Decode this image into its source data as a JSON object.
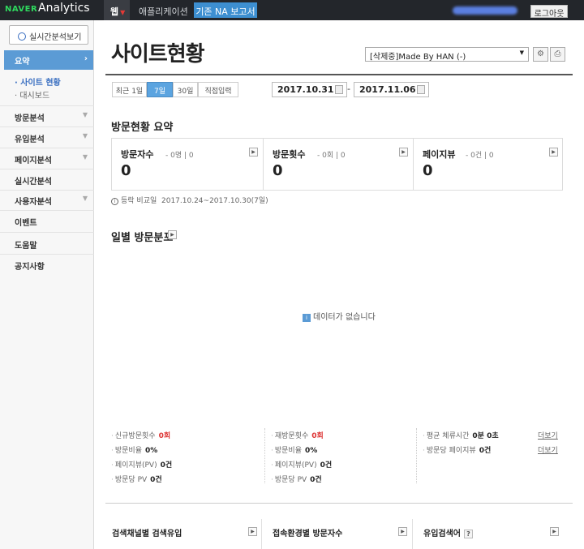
{
  "topbar": {
    "brand_naver": "NAVER",
    "brand_analytics": "Analytics",
    "nav_web": "웹",
    "nav_app": "애플리케이션",
    "nav_legacy": "기존 NA 보고서",
    "logout": "로그아웃"
  },
  "sidebar": {
    "realtime_button": "실시간분석보기",
    "summary": "요약",
    "sub_site": "· 사이트 현황",
    "sub_dashboard": "· 대시보드",
    "menus": [
      "방문분석",
      "유입분석",
      "페이지분석",
      "실시간분석",
      "사용자분석",
      "이벤트",
      "도움말",
      "공지사항"
    ]
  },
  "header": {
    "title": "사이트현황",
    "site_select": "[삭제중]Made By HAN (-)"
  },
  "date_range": {
    "tabs": [
      "최근 1일",
      "7일",
      "30일",
      "직접입력"
    ],
    "active_tab": "7일",
    "start": "2017.10.31",
    "end": "2017.11.06",
    "separator": "-"
  },
  "summary": {
    "title": "방문현황 요약",
    "cards": [
      {
        "label": "방문자수",
        "sub": "- 0명 | 0",
        "value": "0"
      },
      {
        "label": "방문횟수",
        "sub": "- 0회 | 0",
        "value": "0"
      },
      {
        "label": "페이지뷰",
        "sub": "- 0건 | 0",
        "value": "0"
      }
    ],
    "compare_label": "등락 비교일",
    "compare_range": "2017.10.24~2017.10.30(7일)"
  },
  "daily": {
    "title": "일별 방문분포",
    "no_data": "데이터가 없습니다",
    "no_data_badge": "i"
  },
  "stats": {
    "col1": [
      {
        "label": "신규방문횟수",
        "value": "0회"
      },
      {
        "label": "방문비율",
        "value": "0%"
      },
      {
        "label": "페이지뷰(PV)",
        "value": "0건"
      },
      {
        "label": "방문당 PV",
        "value": "0건"
      }
    ],
    "col2": [
      {
        "label": "재방문횟수",
        "value": "0회"
      },
      {
        "label": "방문비율",
        "value": "0%"
      },
      {
        "label": "페이지뷰(PV)",
        "value": "0건"
      },
      {
        "label": "방문당 PV",
        "value": "0건"
      }
    ],
    "col3": [
      {
        "label": "평균 체류시간",
        "value": "0분 0초"
      },
      {
        "label": "방문당 페이지뷰",
        "value": "0건"
      }
    ],
    "detail_link": "더보기"
  },
  "bottom": {
    "search_channel": "검색채널별 검색유입",
    "env_visitors": "접속환경별 방문자수",
    "inflow_keyword": "유입검색어",
    "help": "?"
  },
  "colors": {
    "topbar": "#23262b",
    "brand_green": "#2fd85e",
    "accent_blue": "#5b9bd5",
    "legacy_button": "#3d8fd1",
    "value_red": "#d33333"
  }
}
